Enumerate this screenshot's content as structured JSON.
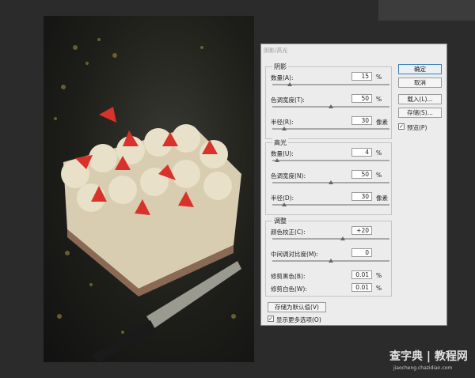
{
  "dialog": {
    "title": "阴影/高光",
    "shadows": {
      "label": "阴影",
      "amount": {
        "label": "数量(A):",
        "value": "15",
        "unit": "%",
        "level": 0.15
      },
      "tonal_width": {
        "label": "色调宽度(T):",
        "value": "50",
        "unit": "%",
        "level": 0.5
      },
      "radius": {
        "label": "半径(R):",
        "value": "30",
        "unit": "像素",
        "level": 0.1
      }
    },
    "highlights": {
      "label": "高光",
      "amount": {
        "label": "数量(U):",
        "value": "4",
        "unit": "%",
        "level": 0.04
      },
      "tonal_width": {
        "label": "色调宽度(N):",
        "value": "50",
        "unit": "%",
        "level": 0.5
      },
      "radius": {
        "label": "半径(D):",
        "value": "30",
        "unit": "像素",
        "level": 0.1
      }
    },
    "adjustments": {
      "label": "调整",
      "color_correction": {
        "label": "颜色校正(C):",
        "value": "+20",
        "unit": "",
        "level": 0.6
      },
      "midtone_contrast": {
        "label": "中间调对比度(M):",
        "value": "0",
        "unit": "",
        "level": 0.5
      },
      "black_clip": {
        "label": "修剪黑色(B):",
        "value": "0.01",
        "unit": "%"
      },
      "white_clip": {
        "label": "修剪白色(W):",
        "value": "0.01",
        "unit": "%"
      }
    },
    "buttons": {
      "ok": "确定",
      "cancel": "取消",
      "load": "载入(L)...",
      "save": "存储(S)...",
      "save_default": "存储为默认值(V)"
    },
    "preview": {
      "label": "预览(P)",
      "checked": true
    },
    "more_options": {
      "label": "显示更多选项(O)",
      "checked": true
    }
  },
  "watermark": {
    "line1": "查字典 | 教程网",
    "line2": "jiaocheng.chazidian.com"
  }
}
